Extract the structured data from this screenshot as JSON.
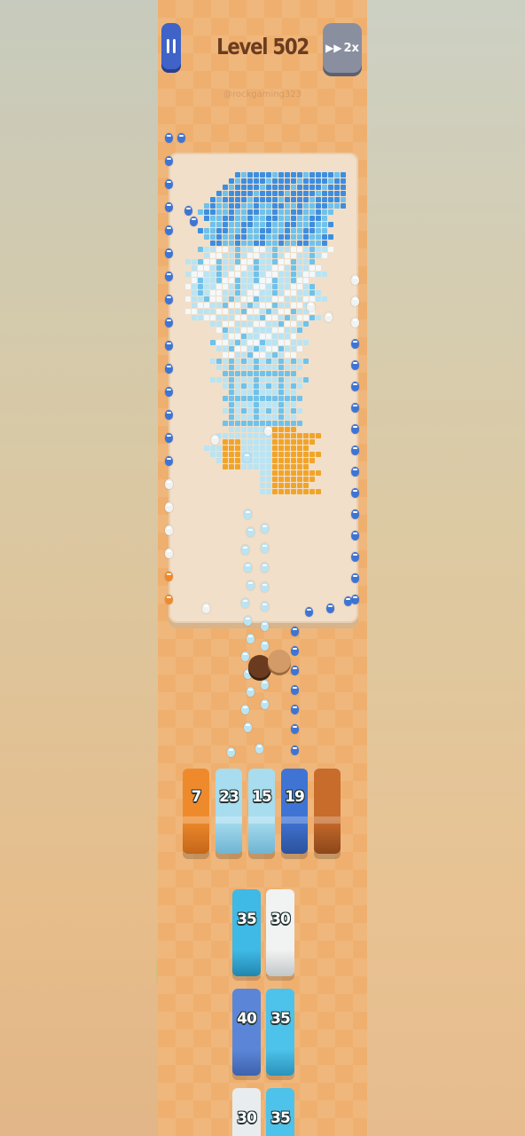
{
  "header": {
    "title": "Level 502",
    "handle": "@rockgaming323",
    "speed_label": "2x"
  },
  "colors": {
    "accent_blue": "#3f63c7",
    "title_brown": "#6b3c1f",
    "board": "#f1dfc9",
    "pixel_dark_blue": "#3d8ee0",
    "pixel_mid_blue": "#6ec2ec",
    "pixel_light_blue": "#b9e4f4",
    "pixel_white": "#f3f8fb",
    "pixel_orange": "#f1a42a"
  },
  "slots": [
    {
      "value": "7",
      "color": "#ee8a2c",
      "shade": "#c4661a"
    },
    {
      "value": "23",
      "color": "#a8dcef",
      "shade": "#6fb5d2"
    },
    {
      "value": "15",
      "color": "#a8dcef",
      "shade": "#6fb5d2"
    },
    {
      "value": "19",
      "color": "#3f74d4",
      "shade": "#2c529c"
    },
    {
      "value": "",
      "color": "#c86c2c",
      "shade": "#8d461a"
    }
  ],
  "queue": [
    {
      "value": "35",
      "color": "#3fb9e6",
      "shade": "#2286b0"
    },
    {
      "value": "30",
      "color": "#f1f2f2",
      "shade": "#c2c7c9"
    },
    {
      "value": "40",
      "color": "#5b86d8",
      "shade": "#3e62ad"
    },
    {
      "value": "35",
      "color": "#4dc2ea",
      "shade": "#2a92bb"
    },
    {
      "value": "30",
      "color": "#e9ecee",
      "shade": "#c0c6c9"
    },
    {
      "value": "35",
      "color": "#4dc2ea",
      "shade": "#2a92bb"
    }
  ],
  "icons": {
    "pause": "pause-icon",
    "speed": "fast-forward-icon"
  }
}
